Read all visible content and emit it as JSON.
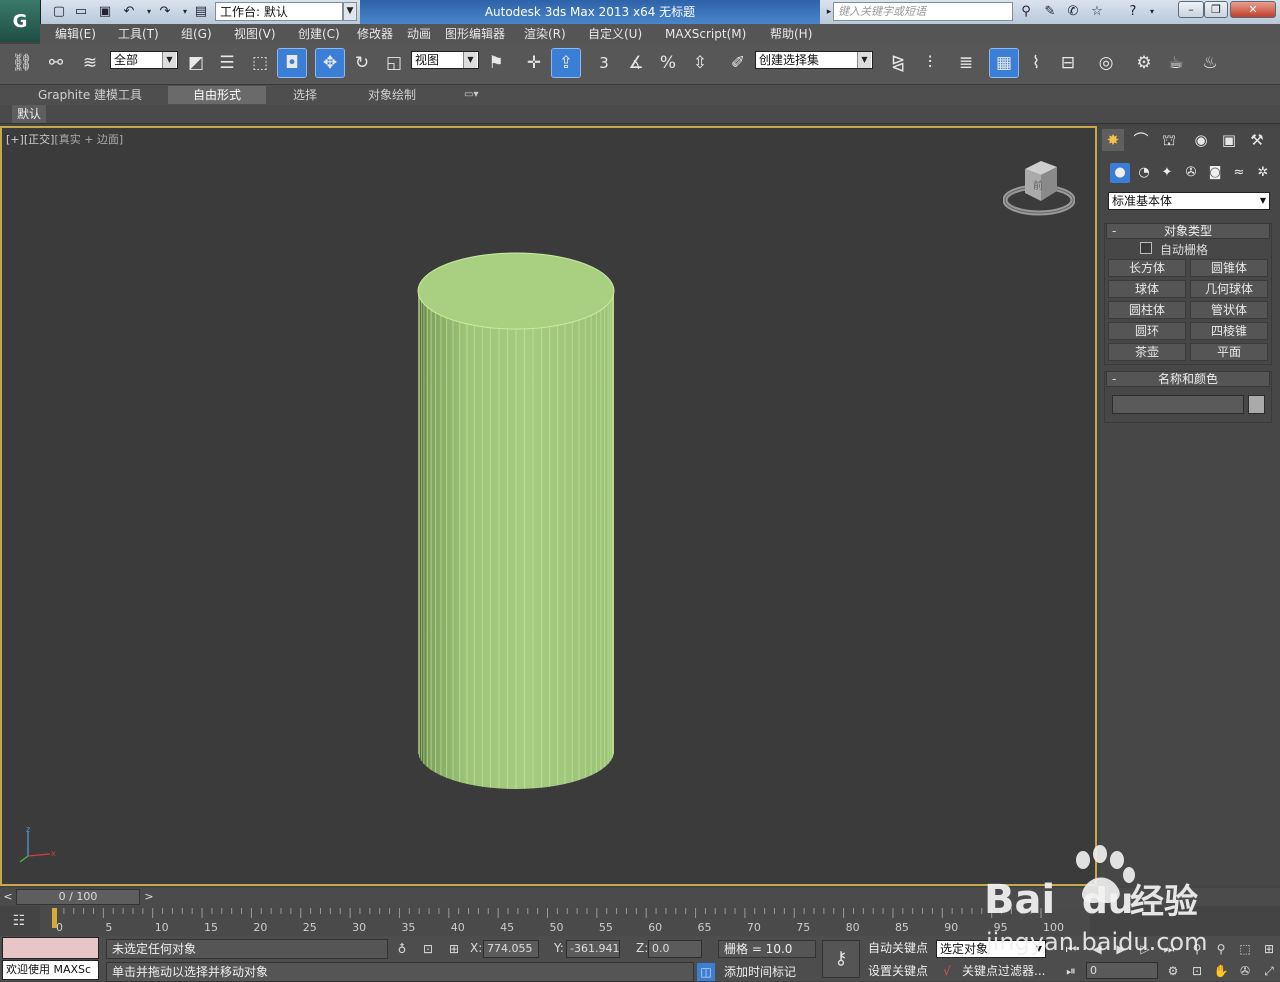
{
  "title_bar": {
    "workspace_label": "工作台: 默认",
    "app_title": "Autodesk 3ds Max  2013 x64      无标题",
    "search_placeholder": "键入关键字或短语"
  },
  "menu": [
    "编辑(E)",
    "工具(T)",
    "组(G)",
    "视图(V)",
    "创建(C)",
    "修改器",
    "动画",
    "图形编辑器",
    "渲染(R)",
    "自定义(U)",
    "MAXScript(M)",
    "帮助(H)"
  ],
  "toolbar": {
    "selection_filter": "全部",
    "reference_coord": "视图",
    "named_selection": "创建选择集",
    "snap_angle_label": "3"
  },
  "ribbon": {
    "tabs": [
      "Graphite 建模工具",
      "自由形式",
      "选择",
      "对象绘制"
    ],
    "active_tab": "自由形式",
    "sub_label": "默认"
  },
  "viewport": {
    "label_plus": "[+]",
    "label_view": "[正交]",
    "label_shading": "[真实 + 边面]",
    "viewcube_face": "前",
    "object_color": "#a8d080"
  },
  "command_panel": {
    "category": "标准基本体",
    "rollout_object_type": "对象类型",
    "autogrid": "自动栅格",
    "object_buttons": [
      "长方体",
      "圆锥体",
      "球体",
      "几何球体",
      "圆柱体",
      "管状体",
      "圆环",
      "四棱锥",
      "茶壶",
      "平面"
    ],
    "rollout_name_color": "名称和颜色",
    "minus": "-"
  },
  "timeline": {
    "slider_text": "0 / 100",
    "prev": "<",
    "next": ">",
    "ticks": [
      "0",
      "5",
      "10",
      "15",
      "20",
      "25",
      "30",
      "35",
      "40",
      "45",
      "50",
      "55",
      "60",
      "65",
      "70",
      "75",
      "80",
      "85",
      "90",
      "95",
      "100"
    ]
  },
  "status": {
    "maxscript_welcome": "欢迎使用 MAXSc",
    "selection_status": "未选定任何对象",
    "prompt": "单击并拖动以选择并移动对象",
    "x_label": "X:",
    "x_value": "774.055",
    "y_label": "Y:",
    "y_value": "-361.941",
    "z_label": "Z:",
    "z_value": "0.0",
    "grid": "栅格 = 10.0",
    "add_time_tag": "添加时间标记",
    "auto_key": "自动关键点",
    "set_key": "设置关键点",
    "key_set_select": "选定对象",
    "key_filters": "关键点过滤器...",
    "frame": "0"
  },
  "watermark": {
    "brand": "Bai",
    "brand2": "du",
    "experience": "经验",
    "url": "jingyan.baidu.com"
  }
}
